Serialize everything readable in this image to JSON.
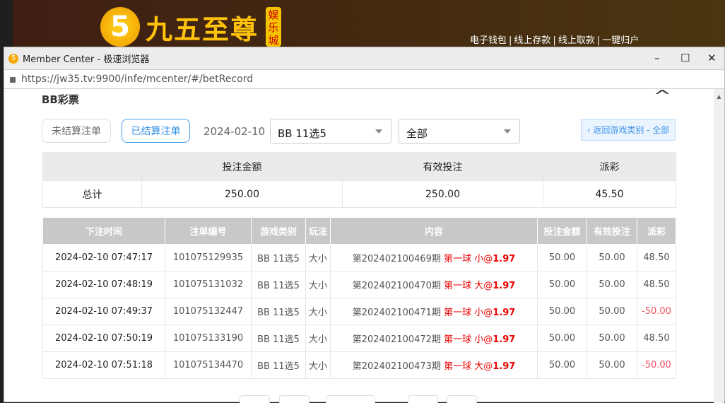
{
  "site": {
    "logo_mark": "5",
    "logo_text": "九五至尊",
    "logo_tag": "娱乐城",
    "links": [
      "电子钱包",
      "线上存款",
      "线上取款",
      "一键归户"
    ]
  },
  "window": {
    "title": "Member Center - 极速浏览器",
    "url": "https://jw35.tv:9900/infe/mcenter/#/betRecord",
    "min": "–",
    "max": "☐",
    "close": "✕"
  },
  "section": {
    "title": "BB彩票",
    "collapse": "^"
  },
  "filters": {
    "unsettled": "未结算注单",
    "settled": "已结算注单",
    "date": "2024-02-10",
    "game": "BB 11选5",
    "play": "全部",
    "back": "‹ 返回游戏类别 - 全部"
  },
  "summary": {
    "headers": [
      "",
      "投注金额",
      "有效投注",
      "派彩"
    ],
    "label": "总计",
    "bet": "250.00",
    "valid": "250.00",
    "payout": "45.50"
  },
  "bets": {
    "headers": [
      "下注时间",
      "注单编号",
      "游戏类别",
      "玩法",
      "内容",
      "投注金额",
      "有效投注",
      "派彩"
    ],
    "rows": [
      {
        "time": "2024-02-10 07:47:17",
        "id": "101075129935",
        "game": "BB 11选5",
        "play": "大小",
        "period": "第202402100469期",
        "pick": "第一球 小@",
        "odds": "1.97",
        "bet": "50.00",
        "valid": "50.00",
        "payout": "48.50"
      },
      {
        "time": "2024-02-10 07:48:19",
        "id": "101075131032",
        "game": "BB 11选5",
        "play": "大小",
        "period": "第202402100470期",
        "pick": "第一球 大@",
        "odds": "1.97",
        "bet": "50.00",
        "valid": "50.00",
        "payout": "48.50"
      },
      {
        "time": "2024-02-10 07:49:37",
        "id": "101075132447",
        "game": "BB 11选5",
        "play": "大小",
        "period": "第202402100471期",
        "pick": "第一球 小@",
        "odds": "1.97",
        "bet": "50.00",
        "valid": "50.00",
        "payout": "-50.00"
      },
      {
        "time": "2024-02-10 07:50:19",
        "id": "101075133190",
        "game": "BB 11选5",
        "play": "大小",
        "period": "第202402100472期",
        "pick": "第一球 小@",
        "odds": "1.97",
        "bet": "50.00",
        "valid": "50.00",
        "payout": "48.50"
      },
      {
        "time": "2024-02-10 07:51:18",
        "id": "101075134470",
        "game": "BB 11选5",
        "play": "大小",
        "period": "第202402100473期",
        "pick": "第一球 大@",
        "odds": "1.97",
        "bet": "50.00",
        "valid": "50.00",
        "payout": "-50.00"
      }
    ]
  }
}
